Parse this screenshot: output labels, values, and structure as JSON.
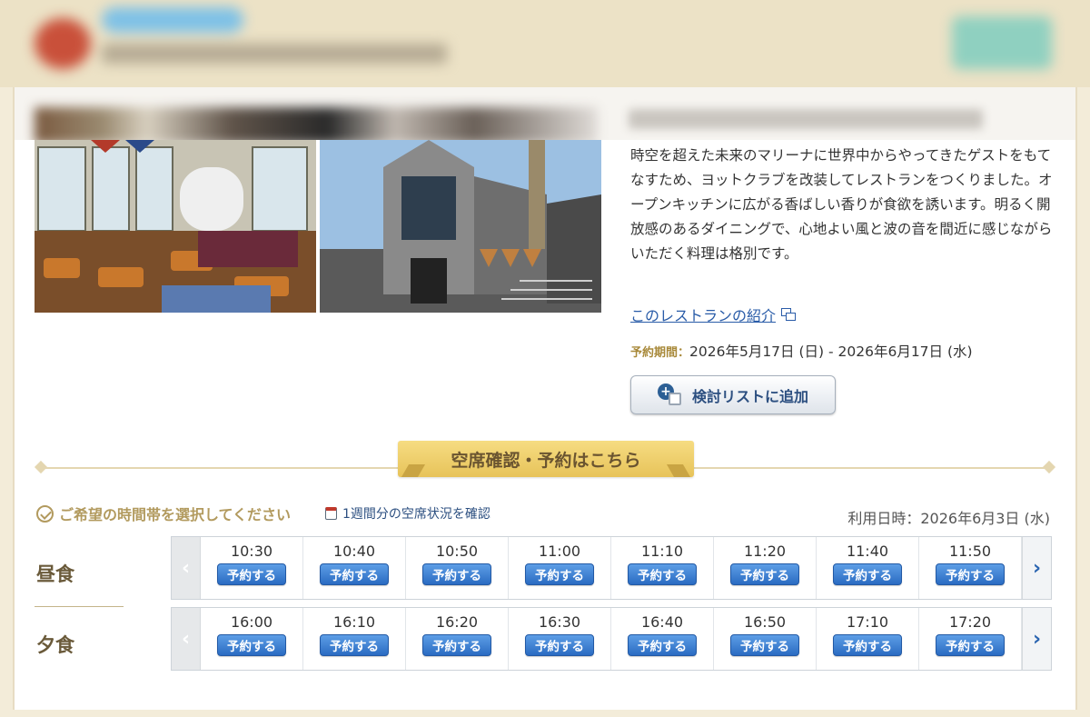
{
  "restaurant": {
    "description": "時空を超えた未来のマリーナに世界中からやってきたゲストをもてなすため、ヨットクラブを改装してレストランをつくりました。オープンキッチンに広がる香ばしい香りが食欲を誘います。明るく開放感のあるダイニングで、心地よい風と波の音を間近に感じながらいただく料理は格別です。",
    "intro_link": "このレストランの紹介",
    "period_label": "予約期間：",
    "period_value": "2026年5月17日 (日) - 2026年6月17日 (水)",
    "add_list_label": "検討リストに追加"
  },
  "reservation": {
    "section_title": "空席確認・予約はこちら",
    "choose_time": "ご希望の時間帯を選択してください",
    "week_link": "1週間分の空席状況を確認",
    "use_date": "利用日時：2026年6月3日 (水)",
    "reserve_label": "予約する",
    "meals": [
      {
        "name": "昼食",
        "times": [
          "10:30",
          "10:40",
          "10:50",
          "11:00",
          "11:10",
          "11:20",
          "11:40",
          "11:50"
        ]
      },
      {
        "name": "夕食",
        "times": [
          "16:00",
          "16:10",
          "16:20",
          "16:30",
          "16:40",
          "16:50",
          "17:10",
          "17:20"
        ]
      }
    ]
  },
  "icons": {
    "prev": "chevron-left-icon",
    "next": "chevron-right-icon",
    "check": "check-circle-icon",
    "calendar": "calendar-icon",
    "window": "new-window-icon"
  },
  "colors": {
    "link": "#2a5ca8",
    "reserve_button": "#2a6bc2",
    "ribbon": "#e7c35a",
    "meal_label": "#6a5a3a"
  }
}
